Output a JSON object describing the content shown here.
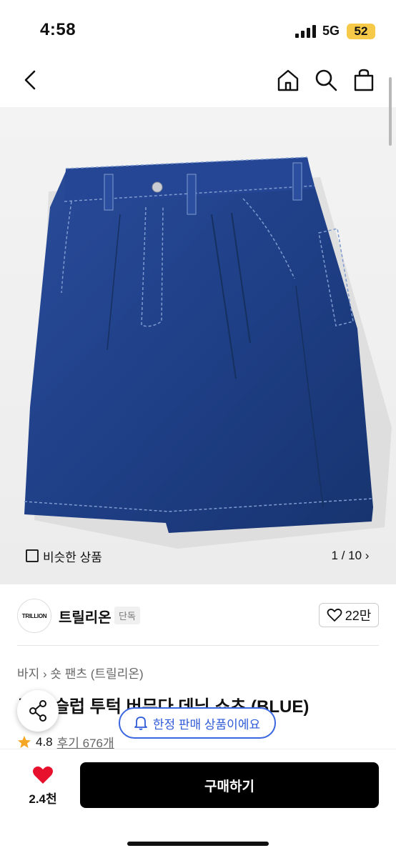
{
  "status": {
    "time": "4:58",
    "network": "5G",
    "battery": "52"
  },
  "gallery": {
    "similar_label": "비슷한 상품",
    "counter": "1 / 10 ›"
  },
  "brand": {
    "logo_text": "TRILLION",
    "name": "트릴리온",
    "badge": "단독",
    "likes": "22만"
  },
  "product": {
    "breadcrumb": "바지 › 숏 팬츠 (트릴리온)",
    "title": "루즈 슬럽 투턱 버뮤다 데님 쇼츠 (BLUE)",
    "rating": "4.8",
    "reviews": "후기 676개"
  },
  "notice": {
    "limited_label": "한정 판매 상품이에요"
  },
  "bottom": {
    "wish_count": "2.4천",
    "buy_label": "구매하기"
  },
  "colors": {
    "accent_blue": "#2f5bd8",
    "star": "#f5a623",
    "heart": "#e8112d",
    "denim": "#1f3f87"
  }
}
